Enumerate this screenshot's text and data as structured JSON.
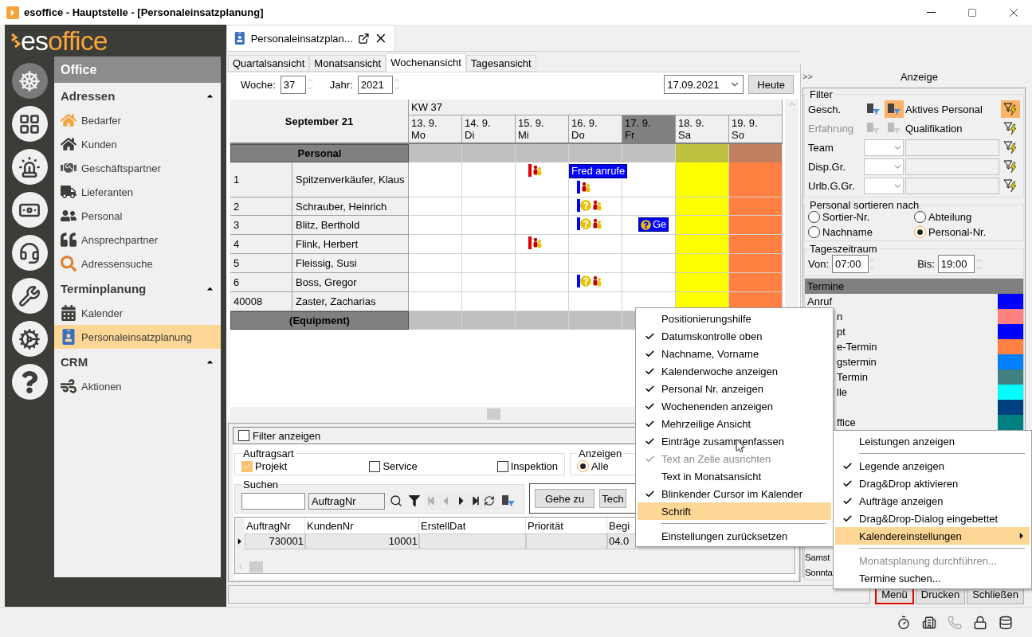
{
  "window": {
    "title": "esoffice - Hauptstelle - [Personaleinsatzplanung]"
  },
  "logo": {
    "prefix": "es",
    "suffix": "office"
  },
  "rail": [
    {
      "kind": "wheel",
      "selected": true
    },
    {
      "kind": "board",
      "selected": false
    },
    {
      "kind": "siren",
      "selected": false
    },
    {
      "kind": "money",
      "selected": false
    },
    {
      "kind": "headset",
      "selected": false
    },
    {
      "kind": "tools",
      "selected": false
    },
    {
      "kind": "gears",
      "selected": false
    },
    {
      "kind": "help",
      "selected": false
    }
  ],
  "nav": {
    "title": "Office",
    "sections": [
      {
        "title": "Adressen",
        "expanded": true,
        "items": [
          {
            "label": "Bedarfer",
            "kind": "house-outline",
            "selected": false
          },
          {
            "label": "Kunden",
            "kind": "house",
            "selected": false
          },
          {
            "label": "Geschäftspartner",
            "kind": "handshake",
            "selected": false
          },
          {
            "label": "Lieferanten",
            "kind": "truck",
            "selected": false
          },
          {
            "label": "Personal",
            "kind": "people",
            "selected": false
          },
          {
            "label": "Ansprechpartner",
            "kind": "quote",
            "selected": false
          },
          {
            "label": "Adressensuche",
            "kind": "search",
            "selected": false
          }
        ]
      },
      {
        "title": "Terminplanung",
        "expanded": true,
        "items": [
          {
            "label": "Kalender",
            "kind": "calendar",
            "selected": false
          },
          {
            "label": "Personaleinsatzplanung",
            "kind": "person-calendar",
            "selected": true
          }
        ]
      },
      {
        "title": "CRM",
        "expanded": true,
        "items": [
          {
            "label": "Aktionen",
            "kind": "tornado",
            "selected": false
          }
        ]
      }
    ]
  },
  "doc_tab": {
    "title": "Personaleinsatzplan..."
  },
  "view_tabs": [
    {
      "label": "Quartalsansicht",
      "selected": false
    },
    {
      "label": "Monatsansicht",
      "selected": false
    },
    {
      "label": "Wochenansicht",
      "selected": true
    },
    {
      "label": "Tagesansicht",
      "selected": false
    }
  ],
  "week": {
    "label": "Woche:",
    "value": "37"
  },
  "year": {
    "label": "Jahr:",
    "value": "2021"
  },
  "date": {
    "value": "17.09.2021"
  },
  "today_button": "Heute",
  "calendar": {
    "month": "September 21",
    "week": "KW 37",
    "days": [
      {
        "date": "13. 9.",
        "weekday": "Mo",
        "kind": "workday",
        "selected": false
      },
      {
        "date": "14. 9.",
        "weekday": "Di",
        "kind": "workday",
        "selected": false
      },
      {
        "date": "15. 9.",
        "weekday": "Mi",
        "kind": "workday",
        "selected": false
      },
      {
        "date": "16. 9.",
        "weekday": "Do",
        "kind": "workday",
        "selected": false
      },
      {
        "date": "17. 9.",
        "weekday": "Fr",
        "kind": "workday",
        "selected": true
      },
      {
        "date": "18. 9.",
        "weekday": "Sa",
        "kind": "saturday",
        "selected": false
      },
      {
        "date": "19. 9.",
        "weekday": "So",
        "kind": "sunday",
        "selected": false
      }
    ],
    "groups": [
      {
        "label": "Personal",
        "rows": [
          {
            "number": "1",
            "name": "Spitzenverkäufer, Klaus",
            "cells": [
              [],
              [],
              [
                {
                  "kind": "flag"
                }
              ],
              [
                {
                  "kind": "appointment",
                  "text": "Fred anrufe"
                },
                {
                  "kind": "marker"
                }
              ],
              [],
              [],
              []
            ]
          },
          {
            "number": "2",
            "name": "Schrauber, Heinrich",
            "cells": [
              [],
              [],
              [],
              [
                {
                  "kind": "question"
                }
              ],
              [],
              [],
              []
            ]
          },
          {
            "number": "3",
            "name": "Blitz, Berthold",
            "cells": [
              [],
              [],
              [],
              [
                {
                  "kind": "question"
                }
              ],
              [
                {
                  "kind": "query",
                  "text": "Ge"
                }
              ],
              [],
              []
            ]
          },
          {
            "number": "4",
            "name": "Flink, Herbert",
            "cells": [
              [],
              [],
              [
                {
                  "kind": "flag"
                }
              ],
              [],
              [],
              [],
              []
            ]
          },
          {
            "number": "5",
            "name": "Fleissig, Susi",
            "cells": [
              [],
              [],
              [],
              [],
              [],
              [],
              []
            ]
          },
          {
            "number": "6",
            "name": "Boss, Gregor",
            "cells": [
              [],
              [],
              [],
              [
                {
                  "kind": "question"
                }
              ],
              [],
              [],
              []
            ]
          },
          {
            "number": "40008",
            "name": "Zaster, Zacharias",
            "cells": [
              [],
              [],
              [],
              [],
              [],
              [],
              []
            ]
          }
        ]
      },
      {
        "label": "(Equipment)"
      }
    ]
  },
  "filter_toggle": {
    "label": "Filter anzeigen",
    "checked": false
  },
  "order_types": {
    "title": "Auftragsart",
    "options": [
      {
        "label": "Projekt",
        "checked": true
      },
      {
        "label": "Service",
        "checked": false
      },
      {
        "label": "Inspektion",
        "checked": false
      }
    ]
  },
  "show": {
    "title": "Anzeigen",
    "options": [
      {
        "label": "Alle",
        "selected": true
      }
    ]
  },
  "search": {
    "title": "Suchen",
    "field": "AuftragNr"
  },
  "goto_buttons": [
    "Gehe zu",
    "Tech"
  ],
  "orders_table": {
    "columns": [
      "AuftragNr",
      "KundenNr",
      "ErstellDat",
      "Priorität",
      "Begi"
    ],
    "rows": [
      {
        "selected": true,
        "cells": [
          "730001",
          "10001",
          null,
          null,
          "04.0"
        ]
      }
    ]
  },
  "side_panel": {
    "collapse": ">>",
    "title": "Anzeige",
    "filter": {
      "title": "Filter",
      "rows": [
        {
          "kind": "toggle",
          "label": "Gesch.",
          "value": "Aktives Personal",
          "active": true,
          "disabled": false
        },
        {
          "kind": "toggle",
          "label": "Erfahrung",
          "value": "Qualifikation",
          "active": false,
          "disabled": true
        },
        {
          "kind": "combo",
          "label": "Team"
        },
        {
          "kind": "combo",
          "label": "Disp.Gr."
        },
        {
          "kind": "combo",
          "label": "Urlb.G.Gr."
        }
      ]
    },
    "sort": {
      "title": "Personal sortieren nach",
      "options": [
        {
          "label": "Sortier-Nr.",
          "selected": false
        },
        {
          "label": "Abteilung",
          "selected": false
        },
        {
          "label": "Nachname",
          "selected": false
        },
        {
          "label": "Personal-Nr.",
          "selected": true
        }
      ]
    },
    "time_range": {
      "title": "Tageszeitraum",
      "from_label": "Von:",
      "from": "07:00",
      "to_label": "Bis:",
      "to": "19:00"
    },
    "legend": {
      "title": "Termine",
      "items": [
        {
          "label": "Anruf",
          "color": "#0000ff",
          "kind": "full"
        },
        {
          "label": "n",
          "color": "#ff8080",
          "kind": "clipped"
        },
        {
          "label": "pt",
          "color": "#0000ff",
          "kind": "clipped"
        },
        {
          "label": "e-Termin",
          "color": "#ff8040",
          "kind": "clipped"
        },
        {
          "label": "gstermin",
          "color": "#0080ff",
          "kind": "clipped"
        },
        {
          "label": "Termin",
          "color": "#408080",
          "kind": "clipped"
        },
        {
          "label": "lle",
          "color": "#00ffff",
          "kind": "clipped"
        },
        {
          "color": "#004080"
        },
        {
          "label": "ffice",
          "color": "#008080",
          "kind": "clipped"
        }
      ],
      "weekend": [
        "Samst",
        "Sonnta"
      ]
    }
  },
  "footer_buttons": [
    {
      "label": "Menü",
      "focused": true
    },
    {
      "label": "Drucken",
      "focused": false
    },
    {
      "label": "Schließen",
      "focused": false
    }
  ],
  "status_icons": [
    {
      "kind": "timer",
      "disabled": false
    },
    {
      "kind": "building",
      "disabled": false
    },
    {
      "kind": "phone",
      "disabled": true
    },
    {
      "kind": "lock",
      "disabled": false
    },
    {
      "kind": "database",
      "disabled": false
    }
  ],
  "menu": {
    "items": [
      {
        "kind": "item",
        "label": "Leistungen anzeigen",
        "checked": false,
        "disabled": false,
        "selected": false
      },
      {
        "kind": "separator"
      },
      {
        "kind": "item",
        "label": "Legende anzeigen",
        "checked": true,
        "disabled": false,
        "selected": false
      },
      {
        "kind": "item",
        "label": "Drag&Drop aktivieren",
        "checked": true,
        "disabled": false,
        "selected": false
      },
      {
        "kind": "item",
        "label": "Aufträge anzeigen",
        "checked": true,
        "disabled": false,
        "selected": false
      },
      {
        "kind": "item",
        "label": "Drag&Drop-Dialog eingebettet",
        "checked": true,
        "disabled": false,
        "selected": false
      },
      {
        "kind": "submenu",
        "label": "Kalendereinstellungen",
        "checked": false,
        "disabled": false,
        "selected": true
      },
      {
        "kind": "separator"
      },
      {
        "kind": "item",
        "label": "Monatsplanung durchführen...",
        "checked": false,
        "disabled": true,
        "selected": false
      },
      {
        "kind": "item",
        "label": "Termine suchen...",
        "checked": false,
        "disabled": false,
        "selected": false
      }
    ]
  },
  "submenu": {
    "items": [
      {
        "kind": "item",
        "label": "Positionierungshilfe",
        "checked": false,
        "disabled": false,
        "selected": false
      },
      {
        "kind": "item",
        "label": "Datumskontrolle oben",
        "checked": true,
        "disabled": false,
        "selected": false
      },
      {
        "kind": "item",
        "label": "Nachname, Vorname",
        "checked": true,
        "disabled": false,
        "selected": false
      },
      {
        "kind": "item",
        "label": "Kalenderwoche anzeigen",
        "checked": true,
        "disabled": false,
        "selected": false
      },
      {
        "kind": "item",
        "label": "Personal Nr. anzeigen",
        "checked": true,
        "disabled": false,
        "selected": false
      },
      {
        "kind": "item",
        "label": "Wochenenden anzeigen",
        "checked": true,
        "disabled": false,
        "selected": false
      },
      {
        "kind": "item",
        "label": "Mehrzeilige Ansicht",
        "checked": true,
        "disabled": false,
        "selected": false
      },
      {
        "kind": "item",
        "label": "Einträge zusammenfassen",
        "checked": true,
        "disabled": false,
        "selected": false
      },
      {
        "kind": "item",
        "label": "Text an Zelle ausrichten",
        "checked": true,
        "disabled": true,
        "selected": false
      },
      {
        "kind": "item",
        "label": "Text in Monatsansicht",
        "checked": false,
        "disabled": false,
        "selected": false
      },
      {
        "kind": "item",
        "label": "Blinkender Cursor im Kalender",
        "checked": true,
        "disabled": false,
        "selected": false
      },
      {
        "kind": "item",
        "label": "Schrift",
        "checked": false,
        "disabled": false,
        "selected": true
      },
      {
        "kind": "separator"
      },
      {
        "kind": "item",
        "label": "Einstellungen zurücksetzen",
        "checked": false,
        "disabled": false,
        "selected": false
      }
    ]
  }
}
